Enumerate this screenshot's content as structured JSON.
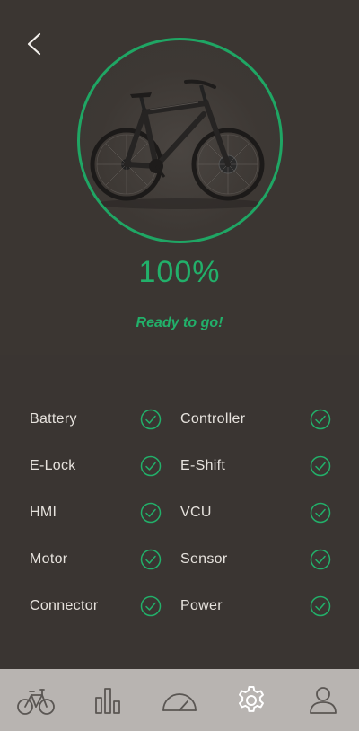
{
  "header": {
    "back_icon": "chevron-left-icon"
  },
  "bike": {
    "image": "e-bike-illustration",
    "ring_color": "#1fa664"
  },
  "charge": {
    "percent_text": "100%",
    "status_text": "Ready to go!"
  },
  "checks": [
    {
      "label": "Battery",
      "ok": true
    },
    {
      "label": "Controller",
      "ok": true
    },
    {
      "label": "E-Lock",
      "ok": true
    },
    {
      "label": "E-Shift",
      "ok": true
    },
    {
      "label": "HMI",
      "ok": true
    },
    {
      "label": "VCU",
      "ok": true
    },
    {
      "label": "Motor",
      "ok": true
    },
    {
      "label": "Sensor",
      "ok": true
    },
    {
      "label": "Connector",
      "ok": true
    },
    {
      "label": "Power",
      "ok": true
    }
  ],
  "nav": {
    "items": [
      {
        "icon": "bike-icon",
        "active": false
      },
      {
        "icon": "stats-icon",
        "active": false
      },
      {
        "icon": "speedometer-icon",
        "active": false
      },
      {
        "icon": "settings-icon",
        "active": true
      },
      {
        "icon": "profile-icon",
        "active": false
      }
    ]
  },
  "colors": {
    "accent": "#22b06a",
    "background": "#3a3532",
    "nav_bar": "#b8b4b1"
  }
}
